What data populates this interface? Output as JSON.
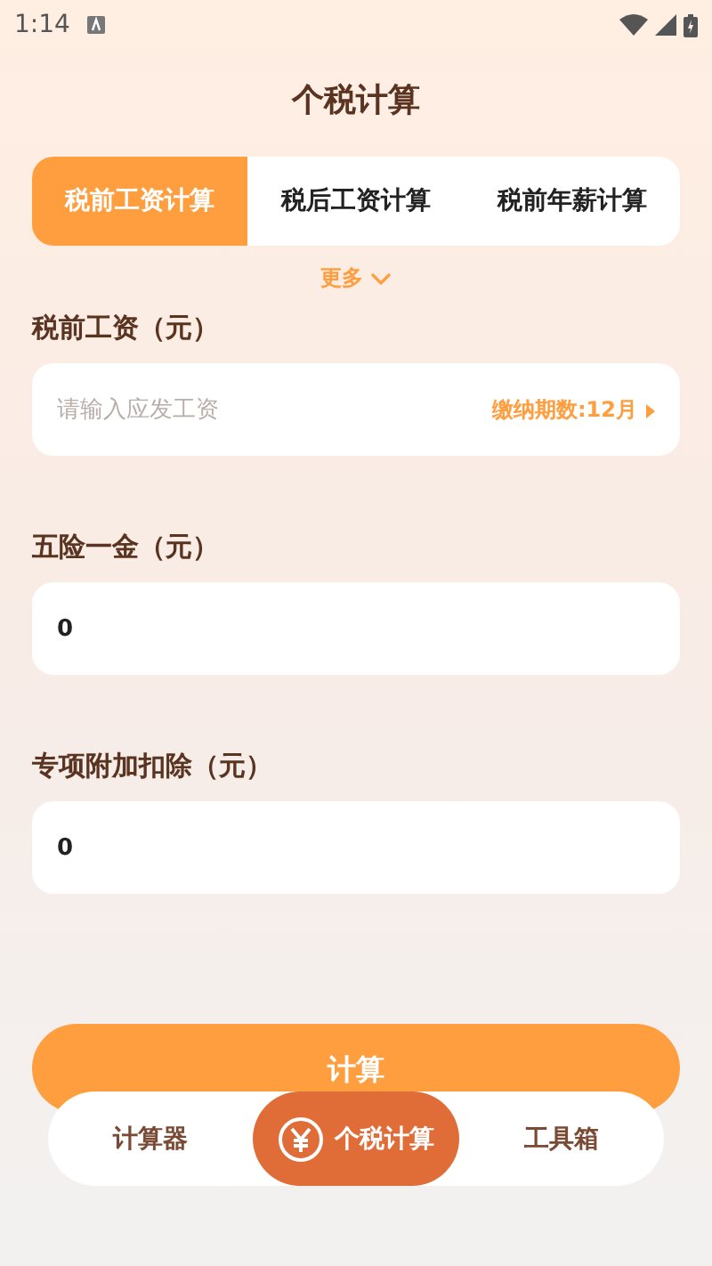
{
  "status_bar": {
    "time": "1:14"
  },
  "title": "个税计算",
  "tabs": [
    {
      "label": "税前工资计算",
      "selected": true
    },
    {
      "label": "税后工资计算",
      "selected": false
    },
    {
      "label": "税前年薪计算",
      "selected": false
    }
  ],
  "more": "更多",
  "fields": [
    {
      "label": "税前工资（元）",
      "placeholder": "请输入应发工资",
      "suffix": "缴纳期数:12月"
    },
    {
      "label": "五险一金（元）",
      "value": "0"
    },
    {
      "label": "专项附加扣除（元）",
      "value": "0"
    }
  ],
  "calculate_button": "计算",
  "bottom_nav": [
    {
      "label": "计算器",
      "selected": false
    },
    {
      "label": "个税计算",
      "selected": true
    },
    {
      "label": "工具箱",
      "selected": false
    }
  ]
}
